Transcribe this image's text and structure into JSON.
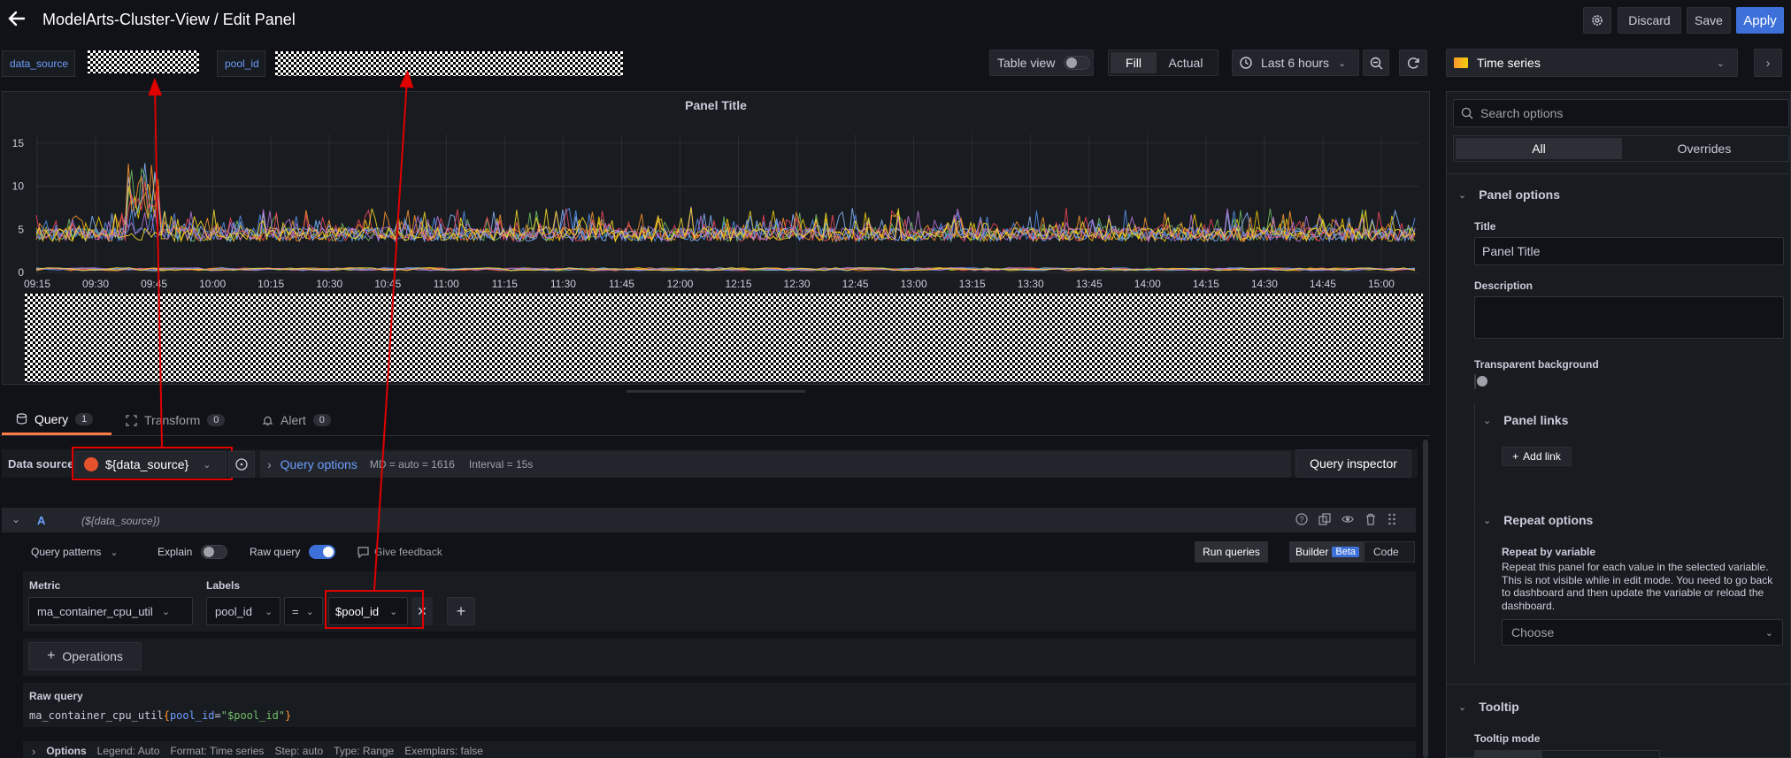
{
  "header": {
    "title": "ModelArts-Cluster-View / Edit Panel",
    "discard": "Discard",
    "save": "Save",
    "apply": "Apply"
  },
  "variables": {
    "data_source_label": "data_source",
    "pool_id_label": "pool_id"
  },
  "toolbar": {
    "table_view": "Table view",
    "fill": "Fill",
    "actual": "Actual",
    "time_range": "Last 6 hours"
  },
  "chart_data": {
    "type": "line",
    "title": "Panel Title",
    "yticks": [
      "15",
      "10",
      "5",
      "0"
    ],
    "ylim": [
      0,
      16
    ],
    "xticks": [
      "09:15",
      "09:30",
      "09:45",
      "10:00",
      "10:15",
      "10:30",
      "10:45",
      "11:00",
      "11:15",
      "11:30",
      "11:45",
      "12:00",
      "12:15",
      "12:30",
      "12:45",
      "13:00",
      "13:15",
      "13:30",
      "13:45",
      "14:00",
      "14:15",
      "14:30",
      "14:45",
      "15:00"
    ],
    "grid": true,
    "series_colors": [
      "#73bf69",
      "#f2cc0c",
      "#8ab8ff",
      "#ff9830",
      "#f2495c",
      "#5794f2",
      "#b877d9",
      "#fade2a"
    ]
  },
  "query_tabs": {
    "query": "Query",
    "query_count": "1",
    "transform": "Transform",
    "transform_count": "0",
    "alert": "Alert",
    "alert_count": "0"
  },
  "query_bar": {
    "data_source_label": "Data source",
    "data_source_value": "${data_source}",
    "query_options": "Query options",
    "md": "MD = auto = 1616",
    "interval": "Interval = 15s",
    "query_inspector": "Query inspector"
  },
  "query_a": {
    "ref": "A",
    "ds": "(${data_source})",
    "patterns": "Query patterns",
    "explain": "Explain",
    "raw_query_toggle": "Raw query",
    "feedback": "Give feedback",
    "run": "Run queries",
    "builder": "Builder",
    "beta": "Beta",
    "code": "Code",
    "metric_label": "Metric",
    "metric_value": "ma_container_cpu_util",
    "labels_label": "Labels",
    "label_key": "pool_id",
    "label_op": "=",
    "label_value": "$pool_id",
    "operations": "Operations",
    "raw_query_label": "Raw query",
    "raw_metric": "ma_container_cpu_util",
    "raw_open": "{",
    "raw_key": "pool_id",
    "raw_eq": "=",
    "raw_val": "\"$pool_id\"",
    "raw_close": "}",
    "options": "Options",
    "legend": "Legend: Auto",
    "format": "Format: Time series",
    "step": "Step: auto",
    "qtype": "Type: Range",
    "exemplars": "Exemplars: false"
  },
  "right": {
    "viz": "Time series",
    "search_placeholder": "Search options",
    "all": "All",
    "overrides": "Overrides",
    "panel_options": "Panel options",
    "title_label": "Title",
    "title_value": "Panel Title",
    "description_label": "Description",
    "transparent_label": "Transparent background",
    "panel_links": "Panel links",
    "add_link": "Add link",
    "repeat_options": "Repeat options",
    "repeat_by": "Repeat by variable",
    "repeat_desc": "Repeat this panel for each value in the selected variable. This is not visible while in edit mode. You need to go back to dashboard and then update the variable or reload the dashboard.",
    "choose": "Choose",
    "tooltip": "Tooltip",
    "tooltip_mode": "Tooltip mode"
  }
}
